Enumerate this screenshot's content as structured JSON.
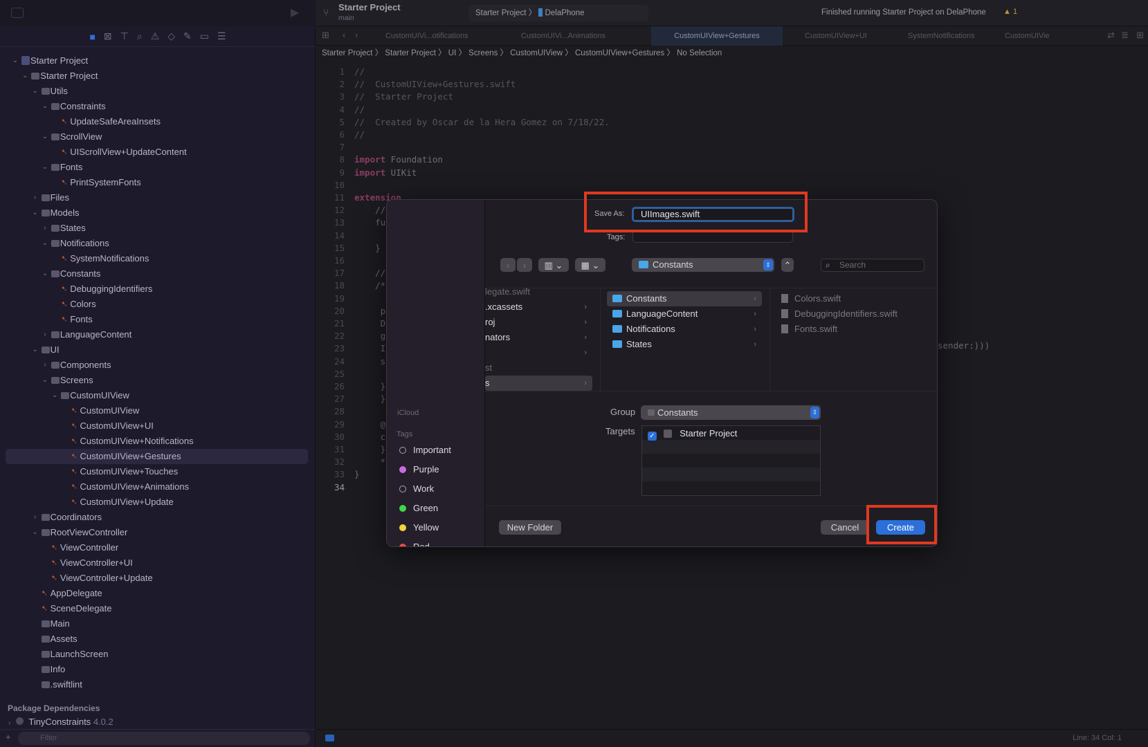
{
  "colors": {
    "accent": "#2c6fd8",
    "highlight": "#e0391f",
    "swift": "#b8542e",
    "folder": "#4aa6e8"
  },
  "sidebar": {
    "nav_icons": [
      "folder-icon",
      "source-control-icon",
      "hierarchy-icon",
      "search-icon",
      "warning-icon",
      "test-icon",
      "debug-icon",
      "breakpoint-icon",
      "report-icon"
    ],
    "tree": [
      {
        "level": 0,
        "type": "proj",
        "name": "Starter Project",
        "open": true
      },
      {
        "level": 1,
        "type": "folder",
        "name": "Starter Project",
        "open": true
      },
      {
        "level": 2,
        "type": "folder",
        "name": "Utils",
        "open": true
      },
      {
        "level": 3,
        "type": "folder",
        "name": "Constraints",
        "open": true
      },
      {
        "level": 4,
        "type": "swift",
        "name": "UpdateSafeAreaInsets"
      },
      {
        "level": 3,
        "type": "folder",
        "name": "ScrollView",
        "open": true
      },
      {
        "level": 4,
        "type": "swift",
        "name": "UIScrollView+UpdateContent"
      },
      {
        "level": 3,
        "type": "folder",
        "name": "Fonts",
        "open": true
      },
      {
        "level": 4,
        "type": "swift",
        "name": "PrintSystemFonts"
      },
      {
        "level": 2,
        "type": "folder",
        "name": "Files",
        "open": false
      },
      {
        "level": 2,
        "type": "folder",
        "name": "Models",
        "open": true
      },
      {
        "level": 3,
        "type": "folder",
        "name": "States",
        "open": false
      },
      {
        "level": 3,
        "type": "folder",
        "name": "Notifications",
        "open": true
      },
      {
        "level": 4,
        "type": "swift",
        "name": "SystemNotifications"
      },
      {
        "level": 3,
        "type": "folder",
        "name": "Constants",
        "open": true
      },
      {
        "level": 4,
        "type": "swift",
        "name": "DebuggingIdentifiers"
      },
      {
        "level": 4,
        "type": "swift",
        "name": "Colors"
      },
      {
        "level": 4,
        "type": "swift",
        "name": "Fonts"
      },
      {
        "level": 3,
        "type": "folder",
        "name": "LanguageContent",
        "open": false
      },
      {
        "level": 2,
        "type": "folder",
        "name": "UI",
        "open": true
      },
      {
        "level": 3,
        "type": "folder",
        "name": "Components",
        "open": false
      },
      {
        "level": 3,
        "type": "folder",
        "name": "Screens",
        "open": true
      },
      {
        "level": 4,
        "type": "folder",
        "name": "CustomUIView",
        "open": true
      },
      {
        "level": 5,
        "type": "swift",
        "name": "CustomUIView"
      },
      {
        "level": 5,
        "type": "swift",
        "name": "CustomUIView+UI"
      },
      {
        "level": 5,
        "type": "swift",
        "name": "CustomUIView+Notifications"
      },
      {
        "level": 5,
        "type": "swift",
        "name": "CustomUIView+Gestures",
        "selected": true
      },
      {
        "level": 5,
        "type": "swift",
        "name": "CustomUIView+Touches"
      },
      {
        "level": 5,
        "type": "swift",
        "name": "CustomUIView+Animations"
      },
      {
        "level": 5,
        "type": "swift",
        "name": "CustomUIView+Update"
      },
      {
        "level": 2,
        "type": "folder",
        "name": "Coordinators",
        "open": false
      },
      {
        "level": 2,
        "type": "folder",
        "name": "RootViewController",
        "open": true
      },
      {
        "level": 3,
        "type": "swift",
        "name": "ViewController"
      },
      {
        "level": 3,
        "type": "swift",
        "name": "ViewController+UI"
      },
      {
        "level": 3,
        "type": "swift",
        "name": "ViewController+Update"
      },
      {
        "level": 2,
        "type": "swift",
        "name": "AppDelegate"
      },
      {
        "level": 2,
        "type": "swift",
        "name": "SceneDelegate"
      },
      {
        "level": 2,
        "type": "xib",
        "name": "Main"
      },
      {
        "level": 2,
        "type": "assets",
        "name": "Assets"
      },
      {
        "level": 2,
        "type": "xib",
        "name": "LaunchScreen"
      },
      {
        "level": 2,
        "type": "plist",
        "name": "Info"
      },
      {
        "level": 2,
        "type": "file",
        "name": ".swiftlint"
      }
    ],
    "package_header": "Package Dependencies",
    "package": {
      "name": "TinyConstraints",
      "version": "4.0.2"
    },
    "filter_placeholder": "Filter"
  },
  "toolbar": {
    "project": "Starter Project",
    "branch": "main",
    "scheme": "Starter Project",
    "device": "DelaPhone",
    "status": "Finished running Starter Project on DelaPhone",
    "warnings": "1"
  },
  "tabs": [
    {
      "label": "CustomUIVi...otifications"
    },
    {
      "label": "CustomUIVi...Animations"
    },
    {
      "label": "CustomUIView+Gestures",
      "active": true
    },
    {
      "label": "CustomUIView+UI"
    },
    {
      "label": "SystemNotifications"
    },
    {
      "label": "CustomUIVie"
    }
  ],
  "breadcrumb": [
    "Starter Project",
    "Starter Project",
    "UI",
    "Screens",
    "CustomUIView",
    "CustomUIView+Gestures",
    "No Selection"
  ],
  "code": [
    {
      "n": "1",
      "t": "//",
      "c": "cm"
    },
    {
      "n": "2",
      "t": "//  CustomUIView+Gestures.swift",
      "c": "cm"
    },
    {
      "n": "3",
      "t": "//  Starter Project",
      "c": "cm"
    },
    {
      "n": "4",
      "t": "//",
      "c": "cm"
    },
    {
      "n": "5",
      "t": "//  Created by Oscar de la Hera Gomez on 7/18/22.",
      "c": "cm"
    },
    {
      "n": "6",
      "t": "//",
      "c": "cm"
    },
    {
      "n": "7",
      "t": ""
    },
    {
      "n": "8",
      "k": "import",
      "t": " Foundation"
    },
    {
      "n": "9",
      "k": "import",
      "t": " UIKit"
    },
    {
      "n": "10",
      "t": ""
    },
    {
      "n": "11",
      "k": "extension",
      "t": ""
    },
    {
      "n": "12",
      "t": "    //"
    },
    {
      "n": "13",
      "t": "    fu"
    },
    {
      "n": "14",
      "t": ""
    },
    {
      "n": "15",
      "t": "    }"
    },
    {
      "n": "16",
      "t": ""
    },
    {
      "n": "17",
      "t": "    //"
    },
    {
      "n": "18",
      "t": "    /*"
    },
    {
      "n": "19",
      "t": ""
    },
    {
      "n": "20",
      "t": "     p"
    },
    {
      "n": "21",
      "t": "     D"
    },
    {
      "n": "22",
      "t": "     g"
    },
    {
      "n": "23",
      "t": "     I"
    },
    {
      "n": "24",
      "t": "     s"
    },
    {
      "n": "25",
      "t": ""
    },
    {
      "n": "26",
      "t": "     }"
    },
    {
      "n": "27",
      "t": "     }"
    },
    {
      "n": "28",
      "t": ""
    },
    {
      "n": "29",
      "t": "     @"
    },
    {
      "n": "30",
      "t": "     c"
    },
    {
      "n": "31",
      "t": "     }"
    },
    {
      "n": "32",
      "t": "     *"
    },
    {
      "n": "33",
      "t": "}"
    },
    {
      "n": "34",
      "t": ""
    }
  ],
  "code_right_fragment": "sender:)))",
  "status": {
    "position": "Line: 34  Col: 1"
  },
  "dialog": {
    "save_as_label": "Save As:",
    "save_as_value": "UIImages.swift",
    "tags_label": "Tags:",
    "location": "Constants",
    "search_placeholder": "Search",
    "col1": [
      {
        "name": "legate.swift",
        "dim": true
      },
      {
        "name": ".xcassets",
        "chev": true
      },
      {
        "name": "roj",
        "chev": true
      },
      {
        "name": "nators",
        "chev": true
      },
      {
        "name": "",
        "chev": true
      },
      {
        "name": "st",
        "dim": true
      },
      {
        "name": "s",
        "chev": true,
        "selected": true
      }
    ],
    "col2": [
      {
        "name": "Constants",
        "selected": true
      },
      {
        "name": "LanguageContent"
      },
      {
        "name": "Notifications"
      },
      {
        "name": "States"
      }
    ],
    "col3": [
      "Colors.swift",
      "DebuggingIdentifiers.swift",
      "Fonts.swift"
    ],
    "side_icloud": "iCloud",
    "side_tags": "Tags",
    "tags": [
      {
        "name": "Important",
        "color": ""
      },
      {
        "name": "Purple",
        "color": "#c86be0"
      },
      {
        "name": "Work",
        "color": ""
      },
      {
        "name": "Green",
        "color": "#3ed64a"
      },
      {
        "name": "Yellow",
        "color": "#f2d33a"
      },
      {
        "name": "Red",
        "color": "#ec4a4a"
      }
    ],
    "group_label": "Group",
    "group_value": "Constants",
    "targets_label": "Targets",
    "target": {
      "name": "Starter Project",
      "checked": true
    },
    "new_folder": "New Folder",
    "cancel": "Cancel",
    "create": "Create"
  }
}
